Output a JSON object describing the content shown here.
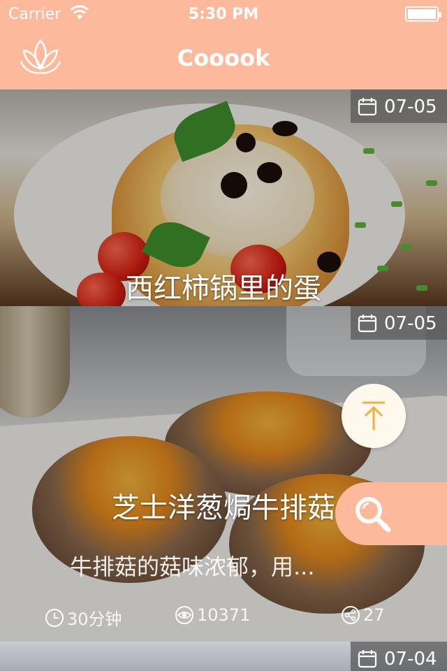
{
  "status_bar": {
    "carrier": "Carrier",
    "time": "5:30 PM"
  },
  "nav": {
    "title": "Cooook",
    "logo_icon": "lotus-logo-icon"
  },
  "colors": {
    "accent": "#FDB99B",
    "white": "#FFFFFF",
    "top_button_arrow": "#F0B040"
  },
  "cards": [
    {
      "date": "07-05",
      "title": "西红柿锅里的蛋"
    },
    {
      "date": "07-05",
      "title": "芝士洋葱焗牛排菇",
      "description": "牛排菇的菇味浓郁，用...",
      "duration": "30分钟",
      "views": "10371",
      "shares": "27"
    },
    {
      "date": "07-04"
    }
  ],
  "buttons": {
    "scroll_top_icon": "arrow-up-to-top-icon",
    "search_icon": "search-icon"
  }
}
